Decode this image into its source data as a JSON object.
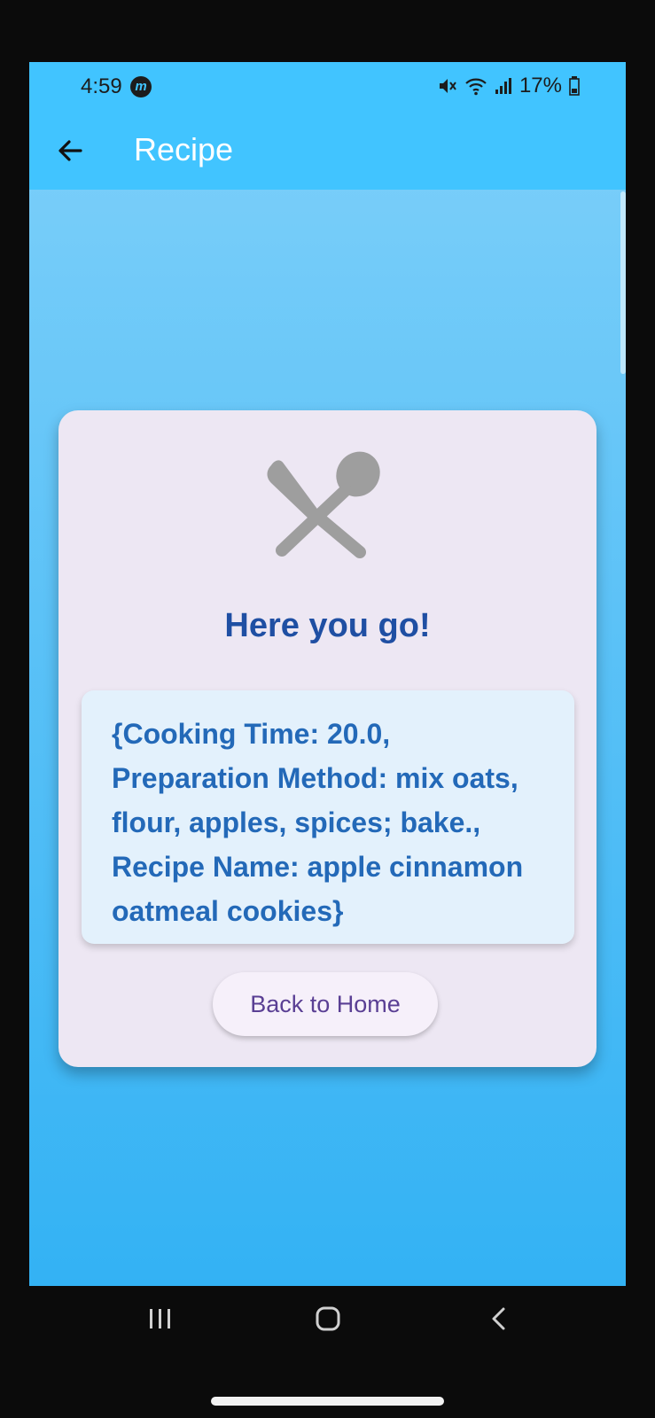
{
  "status_bar": {
    "time": "4:59",
    "badge": "m",
    "battery_text": "17%",
    "icons": [
      "mute-icon",
      "wifi-icon",
      "signal-icon",
      "battery-icon"
    ]
  },
  "app_bar": {
    "title": "Recipe",
    "back_icon": "arrow-left-icon"
  },
  "card": {
    "icon": "utensils-icon",
    "heading": "Here you go!",
    "recipe_text": "{Cooking Time: 20.0, Preparation Method: mix oats, flour, apples, spices; bake., Recipe Name: apple cinnamon oatmeal cookies}",
    "button_label": "Back to Home"
  },
  "system_nav": {
    "icons": [
      "recents-icon",
      "home-icon",
      "back-icon"
    ]
  },
  "colors": {
    "appbar": "#41c4ff",
    "heading": "#1f4fa3",
    "recipe_text": "#2369b8",
    "card_bg": "#ede7f3",
    "button_text": "#5a3f94"
  }
}
